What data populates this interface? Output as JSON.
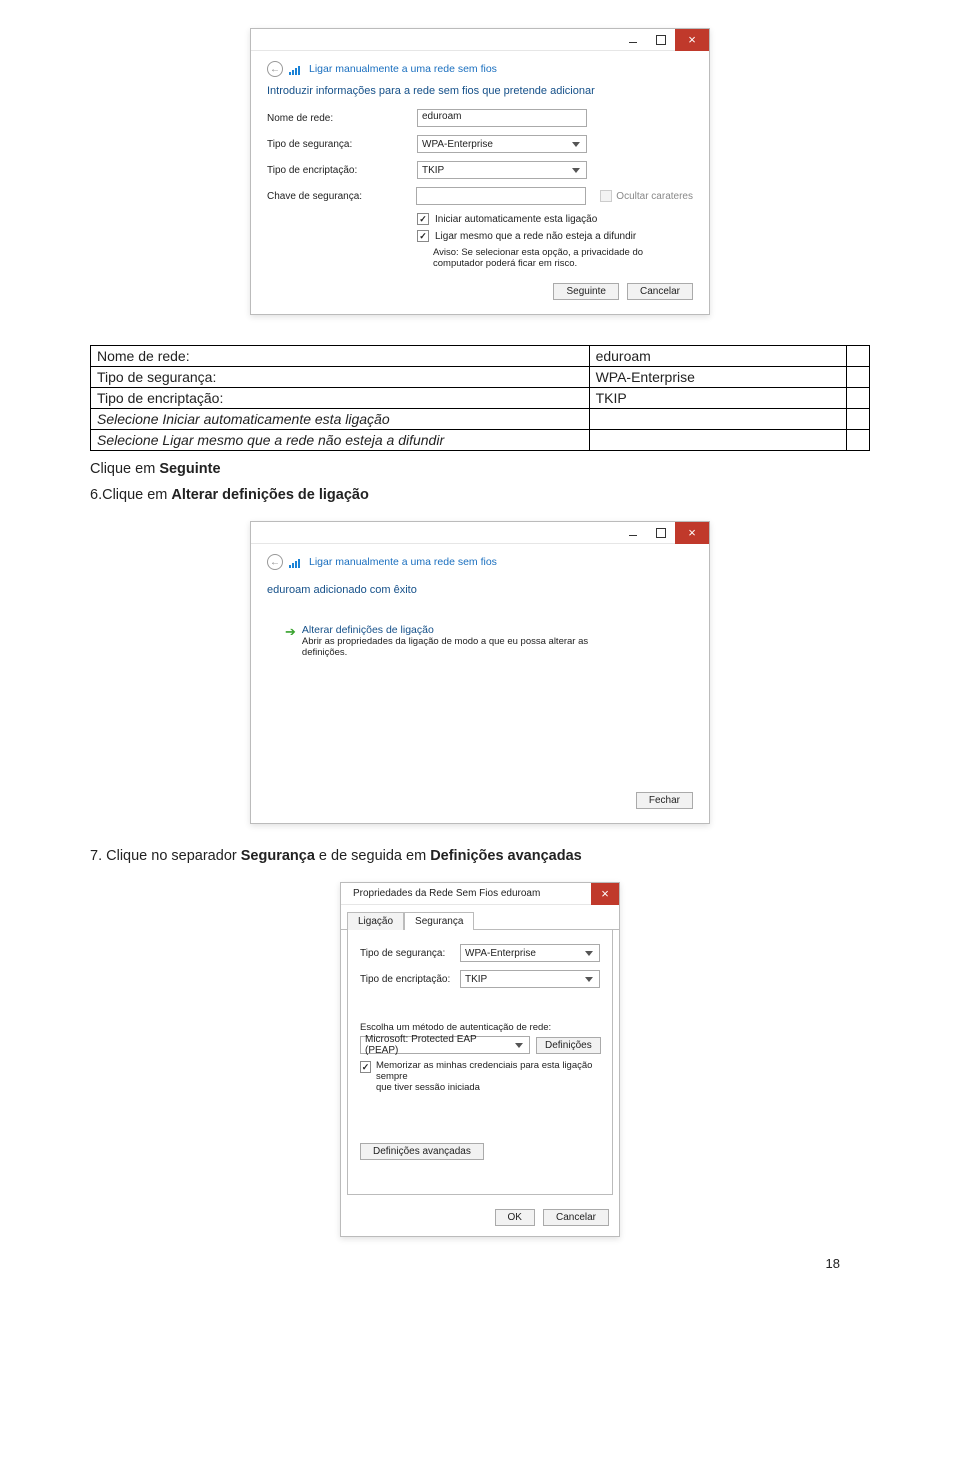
{
  "page_number": "18",
  "dialog1": {
    "header": "Ligar manualmente a uma rede sem fios",
    "subtitle": "Introduzir informações para a rede sem fios que pretende adicionar",
    "labels": {
      "network_name": "Nome de rede:",
      "security_type": "Tipo de segurança:",
      "encryption_type": "Tipo de encriptação:",
      "security_key": "Chave de segurança:"
    },
    "values": {
      "network_name": "eduroam",
      "security_type": "WPA-Enterprise",
      "encryption_type": "TKIP",
      "security_key": ""
    },
    "hide_chars": "Ocultar carateres",
    "cb_auto": "Iniciar automaticamente esta ligação",
    "cb_broadcast": "Ligar mesmo que a rede não esteja a difundir",
    "warning": "Aviso: Se selecionar esta opção, a privacidade do computador poderá ficar em risco.",
    "btn_next": "Seguinte",
    "btn_cancel": "Cancelar"
  },
  "info_table": {
    "r1c1": "Nome de rede:",
    "r1c2": "eduroam",
    "r2c1": "Tipo de segurança:",
    "r2c2": "WPA-Enterprise",
    "r3c1": "Tipo de encriptação:",
    "r3c2": "TKIP",
    "r4c1": "Selecione Iniciar automaticamente esta ligação",
    "r5c1": "Selecione Ligar mesmo que a rede não esteja a difundir"
  },
  "text_after_table_prefix": "Clique em ",
  "text_after_table_bold": "Seguinte",
  "step6_prefix": "6.Clique em ",
  "step6_bold": "Alterar definições de ligação",
  "dialog2": {
    "header": "Ligar manualmente a uma rede sem fios",
    "added_title": "eduroam adicionado com êxito",
    "link_title": "Alterar definições de ligação",
    "link_sub1": "Abrir as propriedades da ligação de modo a que eu possa alterar as",
    "link_sub2": "definições.",
    "btn_close": "Fechar"
  },
  "step7_prefix": "7. Clique no separador ",
  "step7_b1": "Segurança",
  "step7_mid": " e de seguida em ",
  "step7_b2": "Definições avançadas",
  "dialog3": {
    "title": "Propriedades da Rede Sem Fios eduroam",
    "tab1": "Ligação",
    "tab2": "Segurança",
    "lbl_sec_type": "Tipo de segurança:",
    "lbl_enc_type": "Tipo de encriptação:",
    "val_sec_type": "WPA-Enterprise",
    "val_enc_type": "TKIP",
    "auth_label": "Escolha um método de autenticação de rede:",
    "auth_value": "Microsoft: Protected EAP (PEAP)",
    "btn_defs": "Definições",
    "cb_remember1": "Memorizar as minhas credenciais para esta ligação sempre",
    "cb_remember2": "que tiver sessão iniciada",
    "btn_adv": "Definições avançadas",
    "btn_ok": "OK",
    "btn_cancel": "Cancelar"
  }
}
